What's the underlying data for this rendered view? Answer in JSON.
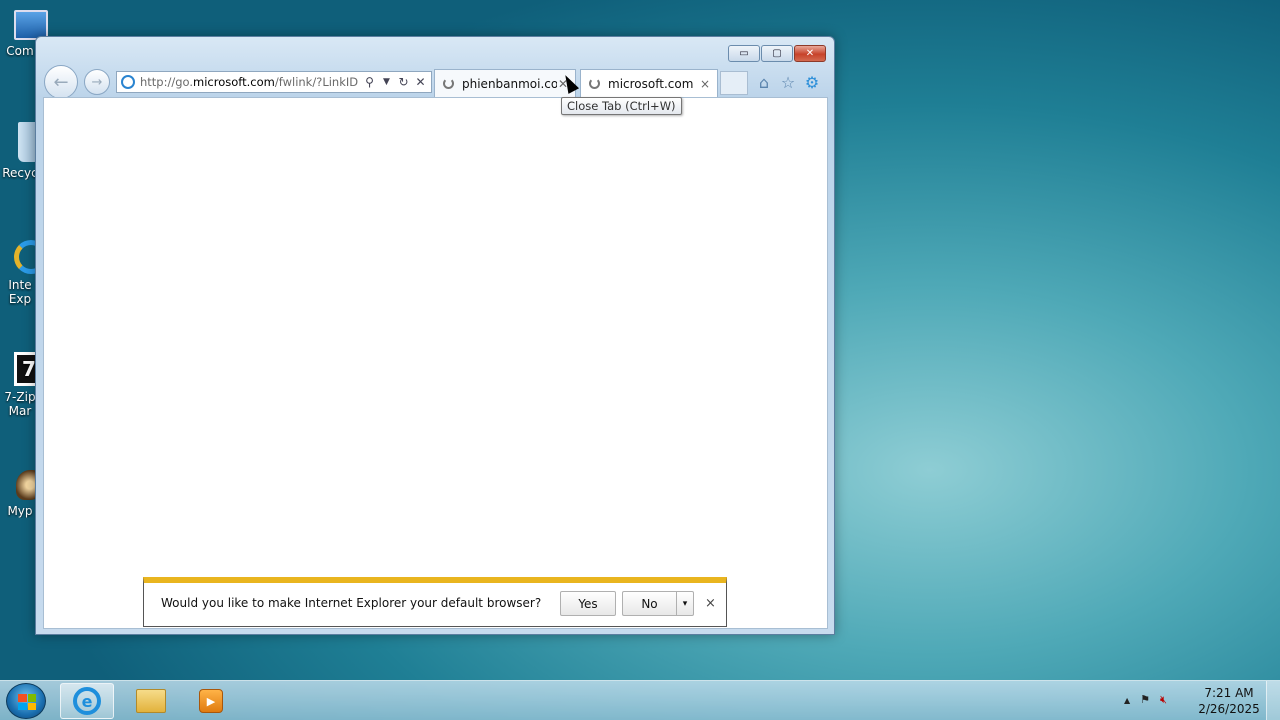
{
  "desktop": {
    "icons": [
      {
        "label": "Com",
        "icon": "computer-icon"
      },
      {
        "label": "Recyc",
        "icon": "recycle-bin-icon"
      },
      {
        "label": "Inte\nExp",
        "line1": "Inte",
        "line2": "Exp",
        "icon": "internet-explorer-icon"
      },
      {
        "line1": "7-Zip",
        "line2": "Mar",
        "icon": "7zip-icon"
      },
      {
        "line1": "Myp",
        "icon": "mypaint-icon"
      }
    ]
  },
  "browser": {
    "address_prefix": "http://go.",
    "address_domain": "microsoft.com",
    "address_suffix": "/fwlink/?LinkID=",
    "tabs": [
      {
        "label": "phienbanmoi.co...",
        "close": "✕"
      },
      {
        "label": "microsoft.com",
        "close": "×"
      }
    ],
    "tooltip": "Close Tab (Ctrl+W)",
    "window_controls": {
      "minimize": "▭",
      "maximize": "▢",
      "close": "✕"
    }
  },
  "notification": {
    "message": "Would you like to make Internet Explorer your default browser?",
    "yes_label": "Yes",
    "no_label": "No",
    "dropdown": "▾",
    "close": "×"
  },
  "taskbar": {
    "time": "7:21 AM",
    "date": "2/26/2025",
    "tray_arrow": "▲"
  },
  "colors": {
    "notification_bar": "#e9b51f",
    "accent": "#1e8fdc"
  }
}
